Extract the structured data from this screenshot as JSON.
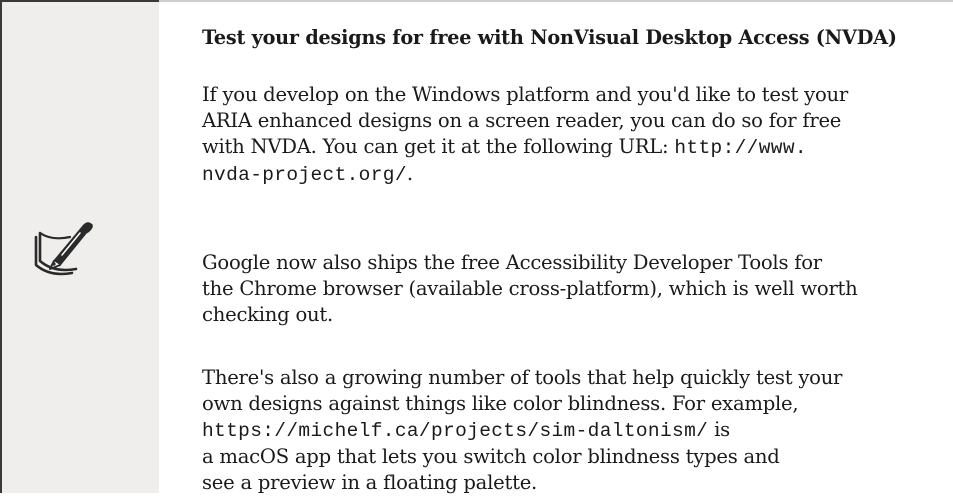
{
  "tip": {
    "icon": "pen-on-paper-icon",
    "title": "Test your designs for free with NonVisual Desktop Access (NVDA)",
    "paragraph1": {
      "line1": "If you develop on the Windows platform and you'd like to test your",
      "line2": "ARIA enhanced designs on a screen reader, you can do so for free",
      "line3_text": "with NVDA. You can get it at the following URL: ",
      "line3_code": "http://www.",
      "line4_code": "nvda-project.org/",
      "line4_text": "."
    },
    "paragraph2": {
      "line1": "Google now also ships the free Accessibility Developer Tools for",
      "line2": "the Chrome browser (available cross-platform), which is well worth",
      "line3": "checking out."
    },
    "paragraph3": {
      "line1": "There's also a growing number of tools that help quickly test your",
      "line2": "own designs against things like color blindness. For example,",
      "line3_code": "https://michelf.ca/projects/sim-daltonism/",
      "line3_text": " is",
      "line4": "a macOS app that lets you switch color blindness types and",
      "line5": "see a preview in a floating palette."
    }
  }
}
